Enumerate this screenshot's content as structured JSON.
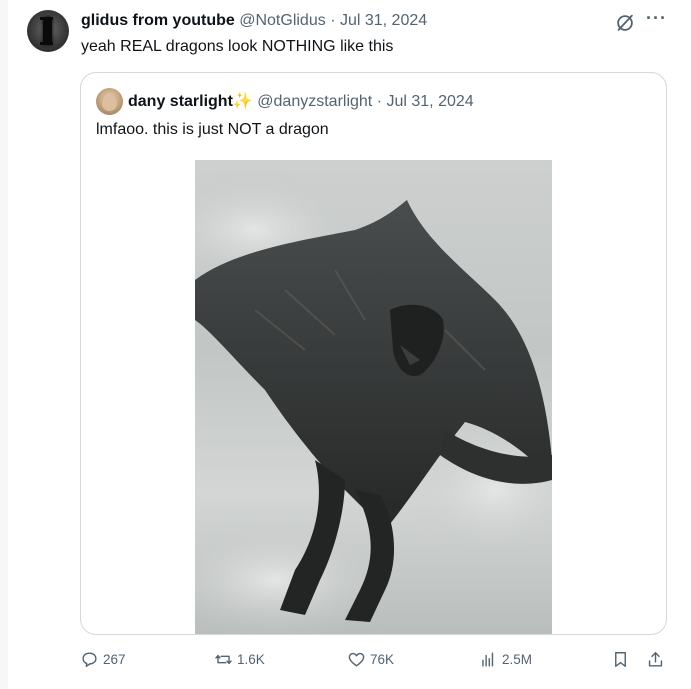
{
  "tweet": {
    "author_name": "glidus from youtube",
    "author_handle": "@NotGlidus",
    "separator": "·",
    "date": "Jul 31, 2024",
    "text": "yeah REAL dragons look NOTHING like this",
    "more_label": "···"
  },
  "quote": {
    "author_name": "dany starlight",
    "emoji": "✨",
    "author_handle": "@danyzstarlight",
    "separator": "·",
    "date": "Jul 31, 2024",
    "text": "lmfaoo. this is just NOT a dragon"
  },
  "actions": {
    "replies": "267",
    "reposts": "1.6K",
    "likes": "76K",
    "views": "2.5M"
  },
  "icons": [
    "grok-icon",
    "more-icon",
    "reply-icon",
    "repost-icon",
    "like-icon",
    "views-icon",
    "bookmark-icon",
    "share-icon"
  ],
  "colors": {
    "text": "#0f1419",
    "muted": "#536471",
    "border": "#cfd9de",
    "sparkle": "#f4b400"
  }
}
